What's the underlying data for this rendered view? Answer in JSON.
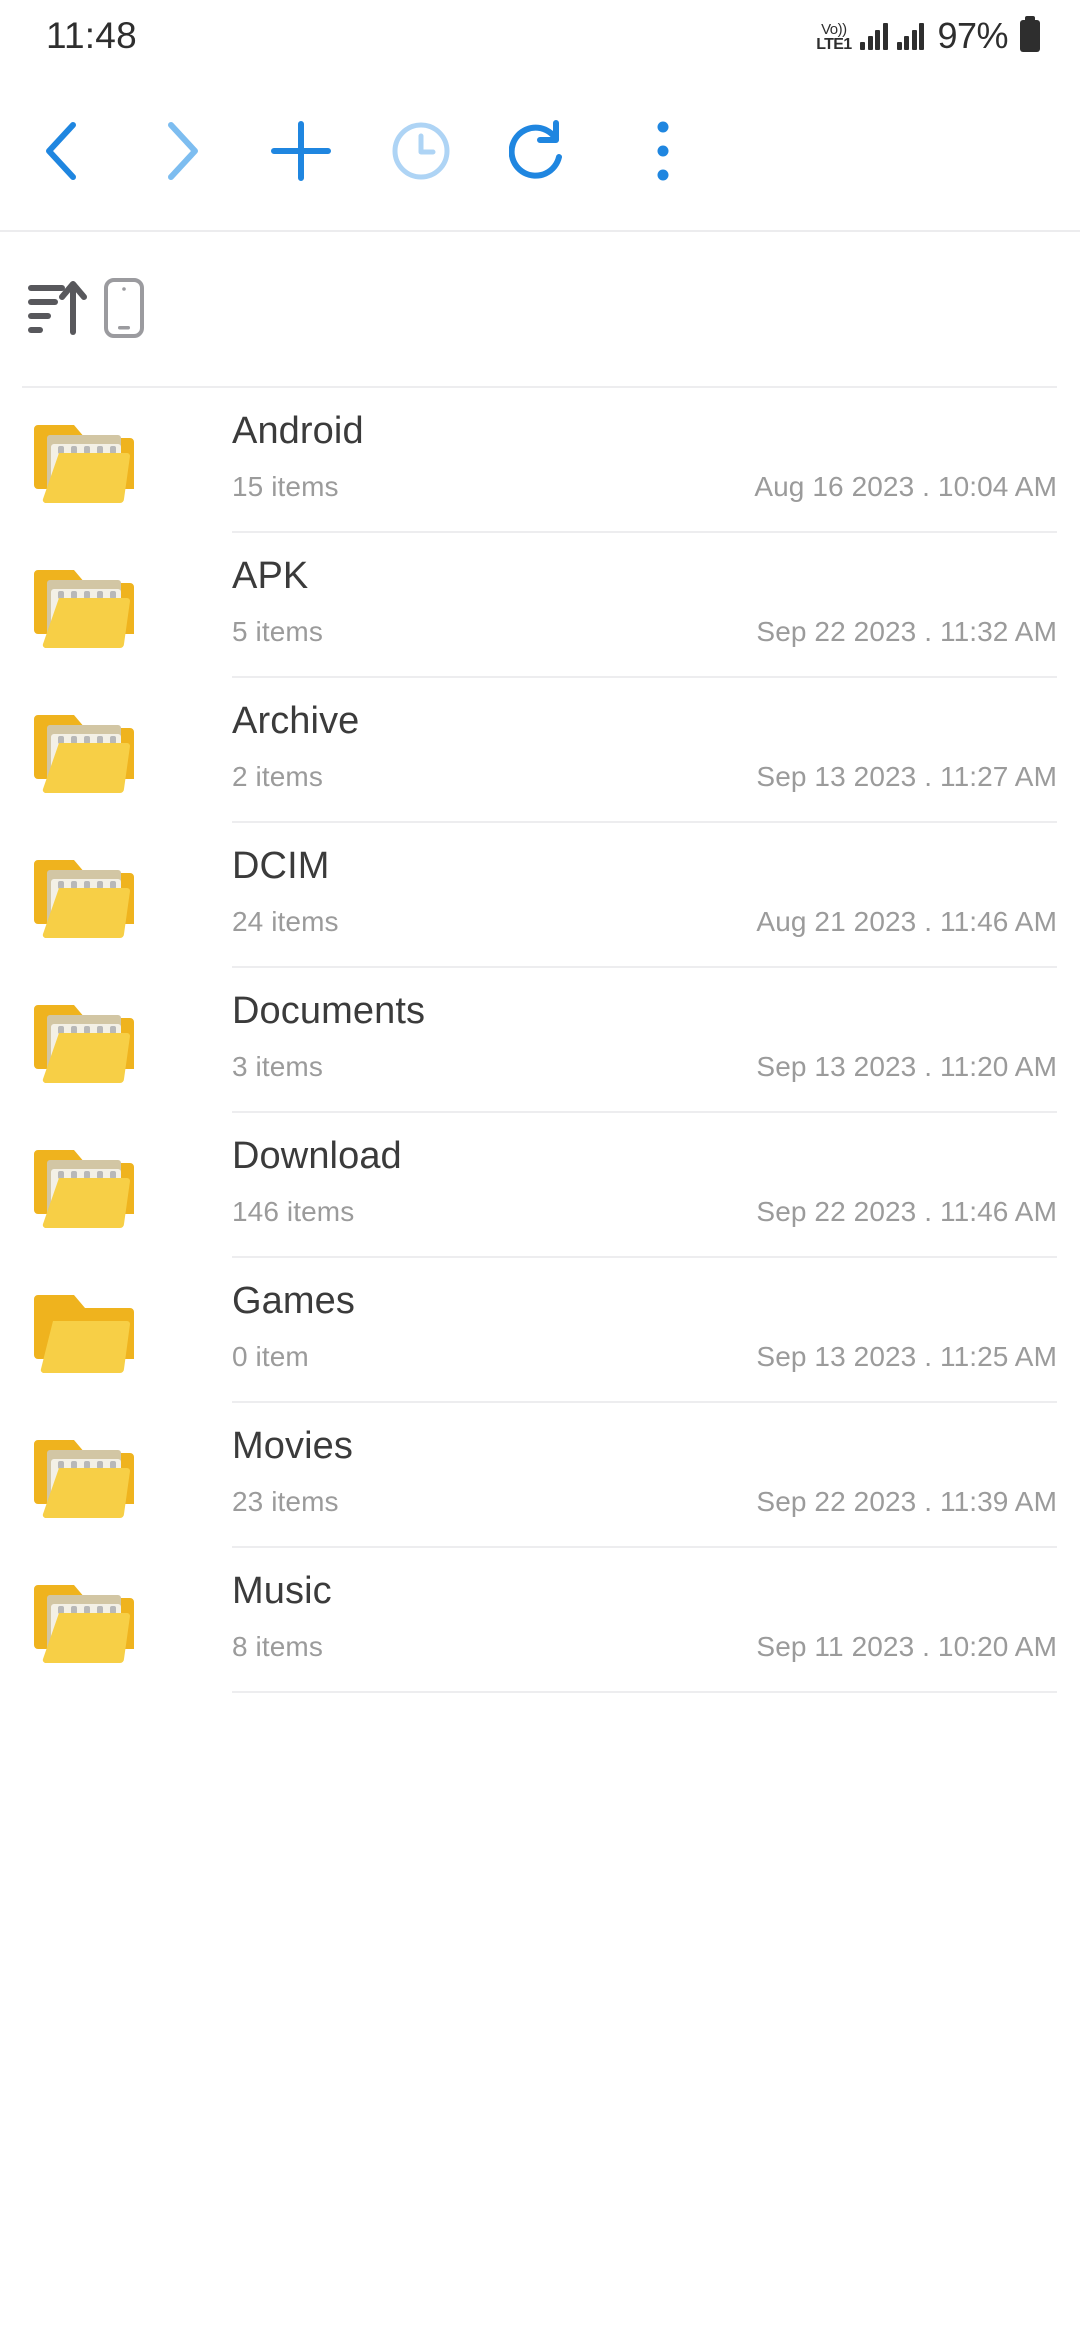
{
  "status_bar": {
    "time": "11:48",
    "network_top": "Vo))",
    "network_label": "LTE1",
    "battery_percent": "97%",
    "signal_icon": "signal-bars-icon",
    "battery_icon": "battery-icon"
  },
  "toolbar": {
    "accent_color": "#1f86e0",
    "accent_muted_color": "#7dbdf0",
    "accent_light_color": "#aed4f5",
    "buttons": [
      {
        "name": "back-button",
        "icon": "chevron-left-icon",
        "state": "enabled"
      },
      {
        "name": "forward-button",
        "icon": "chevron-right-icon",
        "state": "disabled"
      },
      {
        "name": "add-button",
        "icon": "plus-icon",
        "state": "enabled"
      },
      {
        "name": "history-button",
        "icon": "clock-icon",
        "state": "dimmed"
      },
      {
        "name": "refresh-button",
        "icon": "refresh-icon",
        "state": "enabled"
      },
      {
        "name": "more-button",
        "icon": "overflow-menu-icon",
        "state": "enabled"
      }
    ]
  },
  "controls": {
    "icon_color": "#58585c",
    "sort": {
      "name": "sort-ascending-button",
      "icon": "sort-ascending-icon"
    },
    "view": {
      "name": "device-view-button",
      "icon": "phone-device-icon"
    }
  },
  "file_list": {
    "folder_colors": {
      "back": "#efb31e",
      "front": "#f7cf46",
      "paper_tan": "#d2c6a4",
      "paper_cream": "#f3f0e6",
      "notch": "#b8b8b8"
    },
    "rows": [
      {
        "name": "Android",
        "count": "15 items",
        "date": "Aug 16 2023 . 10:04 AM",
        "empty": false
      },
      {
        "name": "APK",
        "count": "5 items",
        "date": "Sep 22 2023 . 11:32 AM",
        "empty": false
      },
      {
        "name": "Archive",
        "count": "2 items",
        "date": "Sep 13 2023 . 11:27 AM",
        "empty": false
      },
      {
        "name": "DCIM",
        "count": "24 items",
        "date": "Aug 21 2023 . 11:46 AM",
        "empty": false
      },
      {
        "name": "Documents",
        "count": "3 items",
        "date": "Sep 13 2023 . 11:20 AM",
        "empty": false
      },
      {
        "name": "Download",
        "count": "146 items",
        "date": "Sep 22 2023 . 11:46 AM",
        "empty": false
      },
      {
        "name": "Games",
        "count": "0 item",
        "date": "Sep 13 2023 . 11:25 AM",
        "empty": true
      },
      {
        "name": "Movies",
        "count": "23 items",
        "date": "Sep 22 2023 . 11:39 AM",
        "empty": false
      },
      {
        "name": "Music",
        "count": "8 items",
        "date": "Sep 11 2023 . 10:20 AM",
        "empty": false
      }
    ]
  }
}
